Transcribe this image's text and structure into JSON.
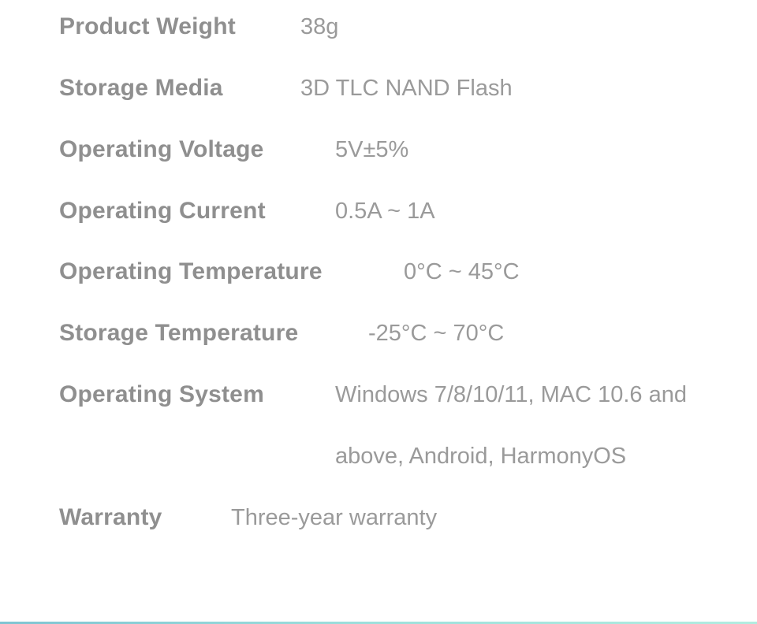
{
  "specs": [
    {
      "label": "Product Weight",
      "value": "38g"
    },
    {
      "label": "Storage Media",
      "value": "3D TLC NAND Flash"
    },
    {
      "label": "Operating Voltage",
      "value": "5V±5%"
    },
    {
      "label": "Operating Current",
      "value": "0.5A ~ 1A"
    },
    {
      "label": "Operating Temperature",
      "value": "0°C ~ 45°C"
    },
    {
      "label": "Storage Temperature",
      "value": "-25°C ~ 70°C"
    },
    {
      "label": "Operating System",
      "value": "Windows 7/8/10/11, MAC 10.6 and",
      "value_continued": "above, Android, HarmonyOS"
    },
    {
      "label": "Warranty",
      "value": "Three-year warranty"
    }
  ],
  "colors": {
    "label": "#8f8f8f",
    "value": "#9a9a9a",
    "accent_line": "#8fd3d8"
  }
}
